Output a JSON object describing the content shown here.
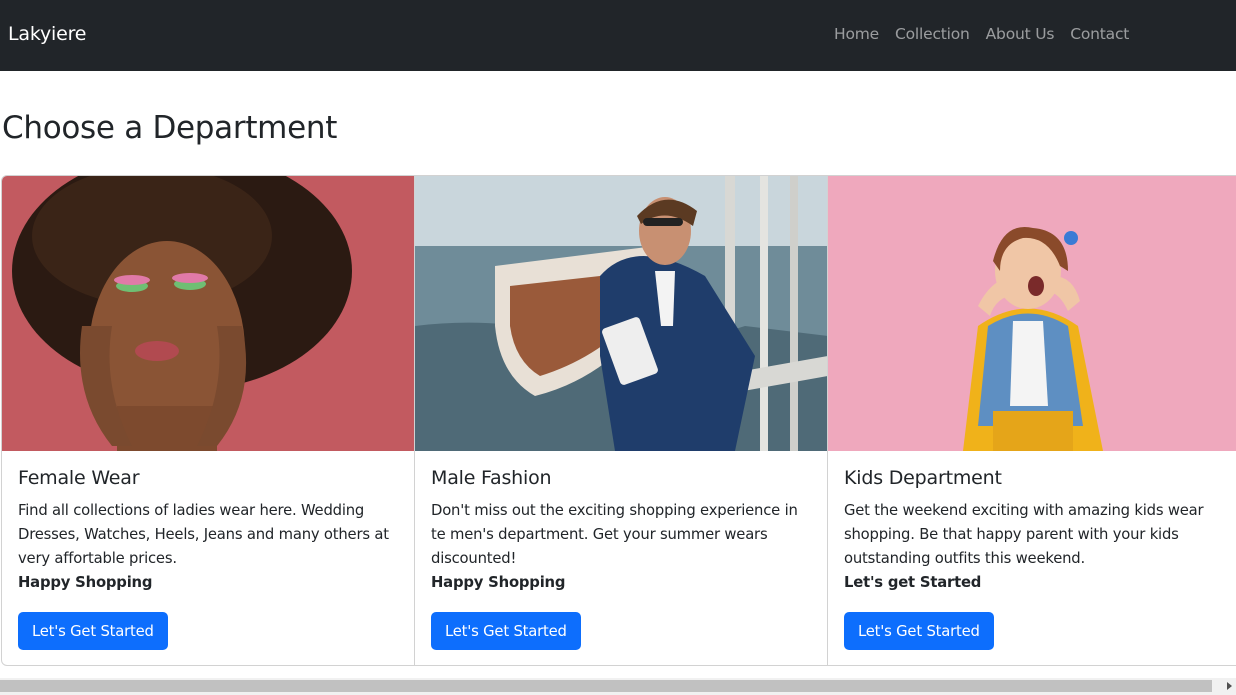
{
  "navbar": {
    "brand": "Lakyiere",
    "links": [
      "Home",
      "Collection",
      "About Us",
      "Contact"
    ]
  },
  "page_title": "Choose a Department",
  "cards": [
    {
      "title": "Female Wear",
      "text": "Find all collections of ladies wear here. Wedding Dresses, Watches, Heels, Jeans and many others at very affortable prices.",
      "strong": "Happy Shopping",
      "button": "Let's Get Started",
      "image": "woman-portrait-photo"
    },
    {
      "title": "Male Fashion",
      "text": "Don't miss out the exciting shopping experience in te men's department. Get your summer wears discounted!",
      "strong": "Happy Shopping",
      "button": "Let's Get Started",
      "image": "man-in-suit-by-boat-photo"
    },
    {
      "title": "Kids Department",
      "text": "Get the weekend exciting with amazing kids wear shopping. Be that happy parent with your kids outstanding outfits this weekend.",
      "strong": "Let's get Started",
      "button": "Let's Get Started",
      "image": "girl-shouting-photo"
    }
  ],
  "colors": {
    "navbar_bg": "#212529",
    "primary": "#0d6efd",
    "card1_bg": "#c0585e",
    "card3_bg": "#efa8bd"
  }
}
